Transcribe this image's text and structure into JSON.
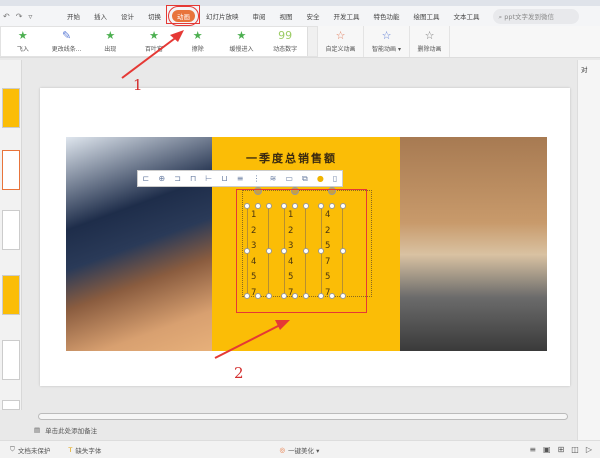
{
  "menu": {
    "tabs": [
      "开始",
      "插入",
      "设计",
      "切换",
      "动画",
      "幻灯片放映",
      "审阅",
      "视图",
      "安全",
      "开发工具",
      "特色功能",
      "绘图工具",
      "文本工具"
    ],
    "active": "动画",
    "search_placeholder": "ppt文字发到微信"
  },
  "ribbon": {
    "gallery": [
      {
        "label": "飞入",
        "icon": "star"
      },
      {
        "label": "更改线条...",
        "icon": "pen"
      },
      {
        "label": "出现",
        "icon": "star"
      },
      {
        "label": "百叶窗",
        "icon": "star"
      },
      {
        "label": "擦除",
        "icon": "star"
      },
      {
        "label": "缓慢进入",
        "icon": "star"
      },
      {
        "label": "动态数字",
        "icon": "99"
      }
    ],
    "buttons": [
      "自定义动画",
      "智能动画 ▾",
      "删除动画"
    ]
  },
  "slide": {
    "title": "一季度总销售额",
    "columns": [
      [
        "1",
        "2",
        "3",
        "4",
        "5",
        "7"
      ],
      [
        "1",
        "2",
        "3",
        "4",
        "5",
        "7"
      ],
      [
        "4",
        "2",
        "5",
        "7",
        "5",
        "7"
      ]
    ]
  },
  "annotations": [
    "1",
    "2"
  ],
  "notes_placeholder": "单击此处添加备注",
  "right_panel": "对",
  "status": {
    "protect": "文档未保护",
    "font": "缺失字体",
    "beautify": "一键美化 ▾"
  }
}
